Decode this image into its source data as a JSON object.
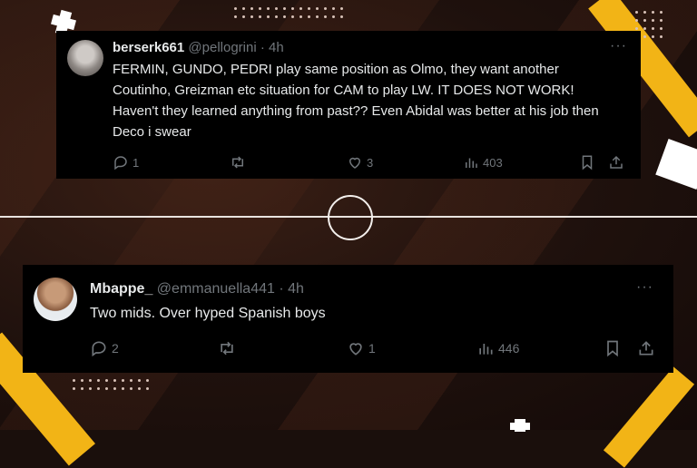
{
  "colors": {
    "accent": "#f2b416",
    "card_bg": "#000000",
    "text": "#e7e9ea",
    "muted": "#71767b"
  },
  "posts": [
    {
      "display_name": "berserk661",
      "handle": "@pellogrini",
      "time": "· 4h",
      "text": "FERMIN, GUNDO, PEDRI play same position as Olmo, they want another Coutinho, Greizman etc situation for CAM to play LW. IT DOES NOT WORK! Haven't they learned anything from past?? Even Abidal was better at his job then Deco i swear",
      "more": "···",
      "replies": "1",
      "reposts": "",
      "likes": "3",
      "views": "403"
    },
    {
      "display_name": "Mbappe_",
      "handle": "@emmanuella441",
      "time": "· 4h",
      "text": "Two mids. Over hyped Spanish boys",
      "more": "···",
      "replies": "2",
      "reposts": "",
      "likes": "1",
      "views": "446"
    }
  ],
  "icons": [
    "reply-icon",
    "repost-icon",
    "like-icon",
    "views-icon",
    "bookmark-icon",
    "share-icon",
    "more-icon"
  ]
}
